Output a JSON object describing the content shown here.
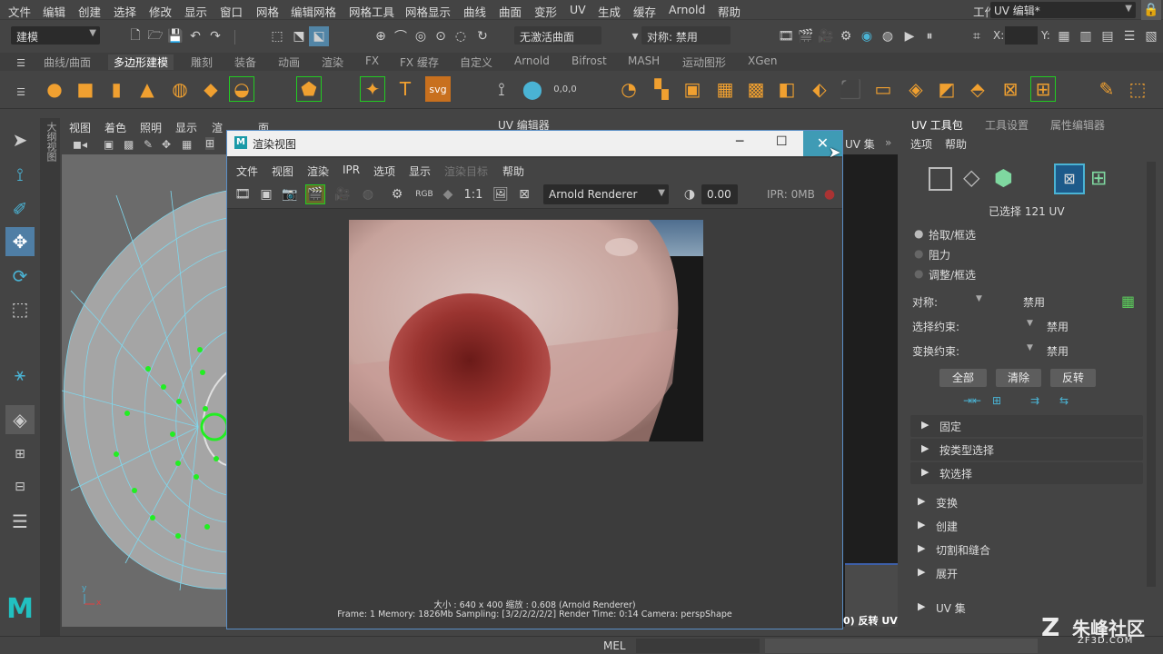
{
  "menubar": {
    "items": [
      "文件",
      "编辑",
      "创建",
      "选择",
      "修改",
      "显示",
      "窗口",
      "网格",
      "编辑网格",
      "网格工具",
      "网格显示",
      "曲线",
      "曲面",
      "变形",
      "UV",
      "生成",
      "缓存",
      "Arnold",
      "帮助"
    ],
    "workspace_label": "工作区:",
    "workspace_value": "UV 编辑*"
  },
  "status_line": {
    "mode": "建模",
    "no_live_surface": "无激活曲面",
    "symmetry": "对称: 禁用",
    "x_label": "X:",
    "y_label": "Y:"
  },
  "shelf_tabs": [
    "曲线/曲面",
    "多边形建模",
    "雕刻",
    "装备",
    "动画",
    "渲染",
    "FX",
    "FX 缓存",
    "自定义",
    "Arnold",
    "Bifrost",
    "MASH",
    "运动图形",
    "XGen"
  ],
  "shelf": {
    "text_tool": "T",
    "svg_tool": "svg",
    "count_label": "0,0,0"
  },
  "viewport_menu": [
    "视图",
    "着色",
    "照明",
    "显示",
    "渲染",
    "面板"
  ],
  "viewport": {
    "side_label": "大纲视图",
    "axis_y": "y",
    "axis_x": "x"
  },
  "uv_editor": {
    "title": "UV 编辑器",
    "uv_set_label": "UV 集",
    "reverse_label": "0) 反转 UV"
  },
  "render_view": {
    "title": "渲染视图",
    "menu": [
      "文件",
      "视图",
      "渲染",
      "IPR",
      "选项",
      "显示",
      "渲染目标",
      "帮助"
    ],
    "ratio": "1:1",
    "rgb": "RGB",
    "renderer": "Arnold Renderer",
    "exposure": "0.00",
    "ipr": "IPR: 0MB",
    "info_line1": "大小 : 640 x 400  缩放 : 0.608     (Arnold Renderer)",
    "info_line2": "Frame: 1    Memory: 1826Mb    Sampling: [3/2/2/2/2/2]    Render Time: 0:14    Camera: perspShape"
  },
  "toolkit": {
    "tabs": [
      "UV 工具包",
      "工具设置",
      "属性编辑器"
    ],
    "menu": [
      "选项",
      "帮助"
    ],
    "selected": "已选择 121 UV",
    "radio": [
      "拾取/框选",
      "阻力",
      "调整/框选"
    ],
    "symmetry_label": "对称:",
    "symmetry_value": "禁用",
    "sel_constraint_label": "选择约束:",
    "sel_constraint_value": "禁用",
    "xform_constraint_label": "变换约束:",
    "xform_constraint_value": "禁用",
    "buttons": [
      "全部",
      "清除",
      "反转"
    ],
    "sections": [
      "固定",
      "按类型选择",
      "软选择",
      "变换",
      "创建",
      "切割和缝合",
      "展开",
      "UV 集"
    ]
  },
  "status_bar": {
    "mel": "MEL"
  },
  "watermark": {
    "name": "朱峰社区",
    "url": "ZF3D.COM"
  },
  "colors": {
    "accent": "#5a8ec6",
    "highlight": "#3d8ec4",
    "green": "#22dd22",
    "selected_blue": "#1d5a8a"
  }
}
